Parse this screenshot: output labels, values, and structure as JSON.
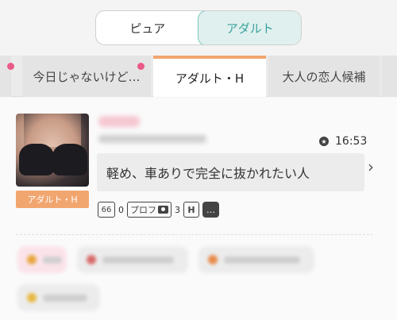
{
  "segment": {
    "options": [
      "ピュア",
      "アダルト"
    ],
    "selected": "アダルト"
  },
  "tabs": [
    {
      "label": ""
    },
    {
      "label": "今日じゃないけど…",
      "has_dot": true
    },
    {
      "label": "アダルト・H",
      "active": true
    },
    {
      "label": "大人の恋人候補"
    },
    {
      "label": ""
    }
  ],
  "post": {
    "category": "アダルト・H",
    "time": "16:53",
    "message": "軽め、車ありで完全に抜かれたい人",
    "photo_count": "0",
    "profile_label": "プロフ",
    "profile_photo_count": "3",
    "hotel_label": "H"
  },
  "colors": {
    "accent_teal": "#3aa39a",
    "accent_orange": "#f2a66f",
    "badge_pink": "#ea5a87"
  },
  "icons": [
    "star-icon",
    "chevron-right-icon",
    "glasses-icon",
    "camera-icon",
    "hotel-icon",
    "chat-icon"
  ]
}
